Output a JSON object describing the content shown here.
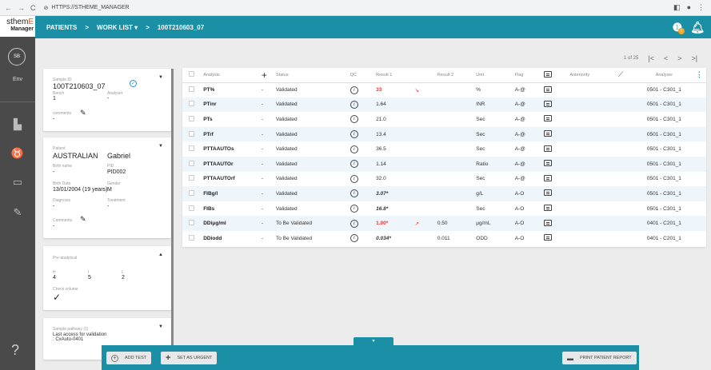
{
  "browser": {
    "url": "HTTPS://STHEME_MANAGER"
  },
  "logo": {
    "line1a": "sthem",
    "line1b": "E",
    "line2": "Manager"
  },
  "user": {
    "initials": "SB",
    "env": "Env"
  },
  "breadcrumb": {
    "patients": "PATIENTS",
    "worklist": "WORK LIST",
    "sample": "100T210603_07"
  },
  "badge_count": "!",
  "sample_card": {
    "label": "Sample ID",
    "id": "100T210603_07",
    "bench_label": "Bench",
    "bench": "1",
    "analyser_label": "Analyser",
    "analyser": "-",
    "comments_label": "comments",
    "comments": "-"
  },
  "patient_card": {
    "label": "Patient",
    "last": "AUSTRALIAN",
    "first": "Gabriel",
    "birth_name_label": "Birth name",
    "birth_name": "-",
    "pid_label": "PID",
    "pid": "PID002",
    "birth_date_label": "Birth Date",
    "birth_date": "13/01/2004 (19 years)",
    "gender_label": "Gender",
    "gender": "M",
    "diagnosis_label": "Diagnosis",
    "diagnosis": "-",
    "treatment_label": "Treatment",
    "treatment": "-",
    "comments_label": "Comments",
    "comments": "-"
  },
  "pre_card": {
    "title": "Pre-analytical",
    "h_label": "H",
    "h": "4",
    "i_label": "I",
    "i": "5",
    "l_label": "L",
    "l": "2",
    "check_label": "Check volume"
  },
  "pathway_card": {
    "title": "Sample pathway (1)",
    "text": "Last access for validation : CxAuto-0401"
  },
  "pager": {
    "text": "1 of 25"
  },
  "table": {
    "headers": {
      "analysis": "Analysis",
      "status": "Status",
      "qc": "QC",
      "result1": "Result 1",
      "result2": "Result 2",
      "unit": "Unit",
      "flag": "Flag",
      "anteriority": "Anteriority",
      "analyser": "Analyser"
    },
    "rows": [
      {
        "analysis": "PT%",
        "dash": "-",
        "status": "Validated",
        "result1": "33",
        "r1style": "red",
        "trend": "↘",
        "result2": "",
        "unit": "%",
        "flag": "A-@",
        "analyser": "0501 - C301_1"
      },
      {
        "analysis": "PTinr",
        "dash": "-",
        "status": "Validated",
        "result1": "1.64",
        "r1style": "",
        "trend": "",
        "result2": "",
        "unit": "INR",
        "flag": "A-@",
        "analyser": "0501 - C301_1"
      },
      {
        "analysis": "PTs",
        "dash": "-",
        "status": "Validated",
        "result1": "21.0",
        "r1style": "",
        "trend": "",
        "result2": "",
        "unit": "Sec",
        "flag": "A-@",
        "analyser": "0501 - C301_1"
      },
      {
        "analysis": "PTrf",
        "dash": "-",
        "status": "Validated",
        "result1": "13.4",
        "r1style": "",
        "trend": "",
        "result2": "",
        "unit": "Sec",
        "flag": "A-@",
        "analyser": "0501 - C301_1"
      },
      {
        "analysis": "PTTAAUTOs",
        "dash": "-",
        "status": "Validated",
        "result1": "36.5",
        "r1style": "",
        "trend": "",
        "result2": "",
        "unit": "Sec",
        "flag": "A-@",
        "analyser": "0501 - C301_1"
      },
      {
        "analysis": "PTTAAUTOr",
        "dash": "-",
        "status": "Validated",
        "result1": "1.14",
        "r1style": "",
        "trend": "",
        "result2": "",
        "unit": "Ratio",
        "flag": "A-@",
        "analyser": "0501 - C301_1"
      },
      {
        "analysis": "PTTAAUTOrf",
        "dash": "-",
        "status": "Validated",
        "result1": "32.0",
        "r1style": "",
        "trend": "",
        "result2": "",
        "unit": "Sec",
        "flag": "A-@",
        "analyser": "0501 - C301_1"
      },
      {
        "analysis": "FIBg/l",
        "dash": "-",
        "status": "Validated",
        "result1": "3.07*",
        "r1style": "bold",
        "trend": "",
        "result2": "",
        "unit": "g/L",
        "flag": "A-O",
        "analyser": "0501 - C301_1"
      },
      {
        "analysis": "FIBs",
        "dash": "-",
        "status": "Validated",
        "result1": "16.8*",
        "r1style": "bold",
        "trend": "",
        "result2": "",
        "unit": "Sec",
        "flag": "A-O",
        "analyser": "0501 - C301_1"
      },
      {
        "analysis": "DDiμg/ml",
        "dash": "-",
        "status": "To Be Validated",
        "result1": "1.00*",
        "r1style": "red",
        "trend": "↗",
        "result2": "0.50",
        "unit": "μg/mL",
        "flag": "A-O",
        "analyser": "0401 - C201_1"
      },
      {
        "analysis": "DDiodd",
        "dash": "-",
        "status": "To Be Validated",
        "result1": "0.034*",
        "r1style": "bold",
        "trend": "",
        "result2": "0.011",
        "unit": "ODD",
        "flag": "A-O",
        "analyser": "0401 - C201_1"
      }
    ]
  },
  "bottom": {
    "add_test": "ADD TEST",
    "urgent": "SET AS URGENT",
    "print": "PRINT PATIENT REPORT"
  }
}
